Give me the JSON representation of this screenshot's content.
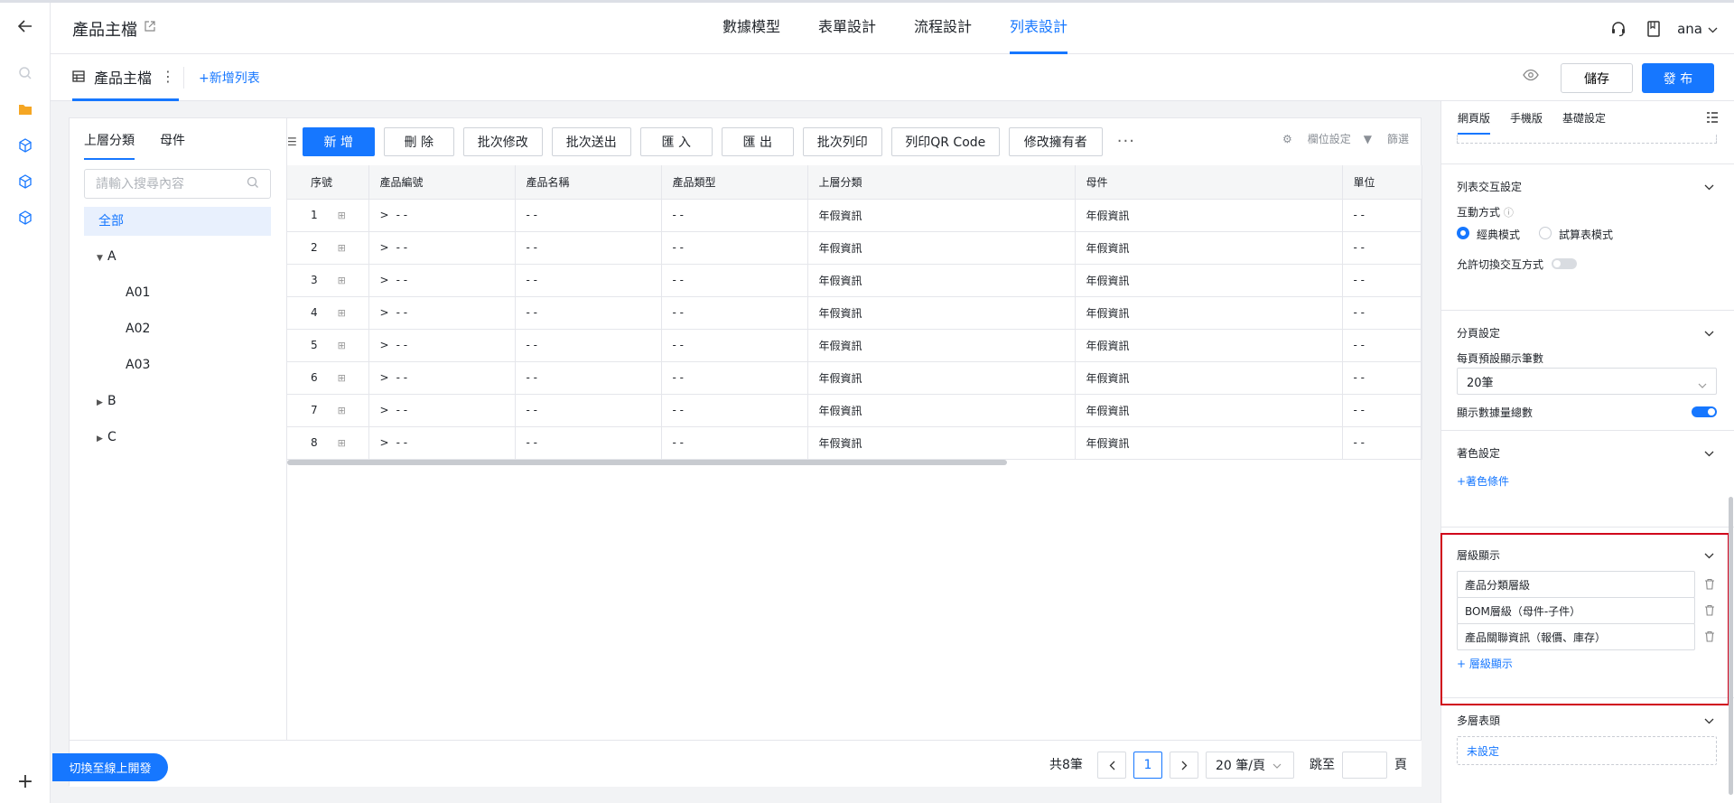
{
  "app": {
    "title": "產品主檔"
  },
  "nav": {
    "tabs": [
      "數據模型",
      "表單設計",
      "流程設計",
      "列表設計"
    ],
    "active": "列表設計"
  },
  "user": {
    "name": "ana"
  },
  "sub": {
    "list_name": "產品主檔",
    "add_list": "+新增列表",
    "save": "儲存",
    "publish": "發 布"
  },
  "tree": {
    "tabs": [
      "上層分類",
      "母件"
    ],
    "search_placeholder": "請輸入搜尋內容",
    "all": "全部",
    "nodes": [
      "A",
      "A01",
      "A02",
      "A03",
      "B",
      "C"
    ]
  },
  "toolbar": {
    "buttons": [
      "新 增",
      "刪 除",
      "批次修改",
      "批次送出",
      "匯 入",
      "匯 出",
      "批次列印",
      "列印QR Code",
      "修改擁有者"
    ],
    "field_settings": "欄位設定",
    "filter": "篩選"
  },
  "table": {
    "columns": [
      "序號",
      "產品編號",
      "產品名稱",
      "產品類型",
      "上層分類",
      "母件",
      "單位"
    ],
    "rows": [
      [
        "1",
        "- -",
        "- -",
        "- -",
        "年假資訊",
        "年假資訊",
        "- -"
      ],
      [
        "2",
        "- -",
        "- -",
        "- -",
        "年假資訊",
        "年假資訊",
        "- -"
      ],
      [
        "3",
        "- -",
        "- -",
        "- -",
        "年假資訊",
        "年假資訊",
        "- -"
      ],
      [
        "4",
        "- -",
        "- -",
        "- -",
        "年假資訊",
        "年假資訊",
        "- -"
      ],
      [
        "5",
        "- -",
        "- -",
        "- -",
        "年假資訊",
        "年假資訊",
        "- -"
      ],
      [
        "6",
        "- -",
        "- -",
        "- -",
        "年假資訊",
        "年假資訊",
        "- -"
      ],
      [
        "7",
        "- -",
        "- -",
        "- -",
        "年假資訊",
        "年假資訊",
        "- -"
      ],
      [
        "8",
        "- -",
        "- -",
        "- -",
        "年假資訊",
        "年假資訊",
        "- -"
      ]
    ]
  },
  "pager": {
    "total": "共8筆",
    "current": "1",
    "page_size": "20 筆/頁",
    "jump_label": "跳至",
    "page_label": "頁"
  },
  "switch_online": "切換至線上開發",
  "panel": {
    "tabs": [
      "網頁版",
      "手機版",
      "基礎設定"
    ],
    "interaction": {
      "title": "列表交互設定",
      "mode_label": "互動方式",
      "options": [
        "經典模式",
        "試算表模式"
      ],
      "selected": "經典模式",
      "allow_switch_label": "允許切換交互方式",
      "allow_switch": false
    },
    "paging": {
      "title": "分頁設定",
      "default_rows_label": "每頁預設顯示筆數",
      "default_rows": "20筆",
      "show_total_label": "顯示數據量總數",
      "show_total": true
    },
    "coloring": {
      "title": "著色設定",
      "add": "+著色條件"
    },
    "levels": {
      "title": "層級顯示",
      "items": [
        "產品分類層級",
        "BOM層級（母件-子件）",
        "產品關聯資訊（報價、庫存）"
      ],
      "add": "+ 層級顯示"
    },
    "multiheader": {
      "title": "多層表頭",
      "value": "未設定"
    }
  },
  "colors": {
    "accent": "#1677ff",
    "highlight": "#d0021b"
  }
}
